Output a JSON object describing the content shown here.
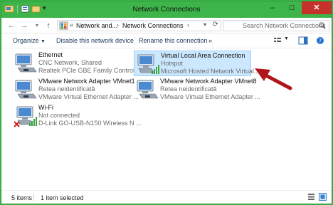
{
  "window": {
    "title": "Network Connections"
  },
  "address": {
    "overflow": "«",
    "crumbs": [
      "Network and...",
      "Network Connections"
    ],
    "separator": "›"
  },
  "search": {
    "placeholder": "Search Network Connections"
  },
  "toolbar": {
    "organize": "Organize",
    "disable": "Disable this network device",
    "rename": "Rename this connection",
    "more": "»"
  },
  "items": [
    {
      "name": "Ethernet",
      "line2": "CNC Network, Shared",
      "line3": "Realtek PCIe GBE Family Controller",
      "icon": "ethernet-adapter-icon"
    },
    {
      "name": "Virtual Local Area Connection",
      "line2": "Hotspot",
      "line3": "Microsoft Hosted Network Virtual...",
      "icon": "wireless-adapter-icon",
      "selected": true
    },
    {
      "name": "VMware Network Adapter VMnet1",
      "line2": "Retea neidentificată",
      "line3": "VMware Virtual Ethernet Adapter ...",
      "icon": "ethernet-adapter-icon"
    },
    {
      "name": "VMware Network Adapter VMnet8",
      "line2": "Retea neidentificată",
      "line3": "VMware Virtual Ethernet Adapter ...",
      "icon": "ethernet-adapter-icon"
    },
    {
      "name": "Wi-Fi",
      "line2": "Not connected",
      "line3": "D-Link GO-USB-N150 Wireless N ...",
      "icon": "wifi-disconnected-icon"
    }
  ],
  "status": {
    "count": "5 items",
    "selected": "1 item selected"
  },
  "colors": {
    "frame": "#3db54a",
    "selection": "#cce8ff",
    "arrow": "#b0151c"
  }
}
